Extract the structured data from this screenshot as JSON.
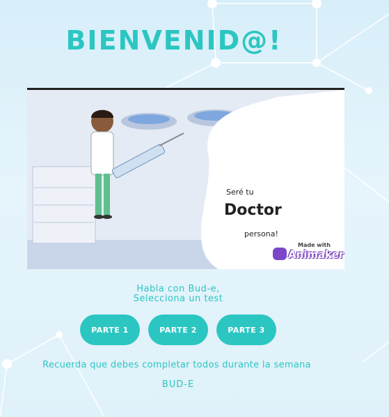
{
  "header": {
    "title": "BIENVENID@!"
  },
  "video": {
    "line1": "Seré tu",
    "line2": "Doctor",
    "line3": "persona!",
    "watermark_top": "Made with",
    "watermark_brand": "Animaker"
  },
  "prompt": {
    "line1": "Habla con Bud-e,",
    "line2": "Selecciona un test"
  },
  "buttons": [
    {
      "label": "PARTE 1"
    },
    {
      "label": "PARTE 2"
    },
    {
      "label": "PARTE 3"
    }
  ],
  "reminder": "Recuerda que debes completar todos durante la semana",
  "footer": {
    "brand": "BUD-E"
  },
  "colors": {
    "accent": "#2cc6c2",
    "background": "#dff1fa"
  }
}
